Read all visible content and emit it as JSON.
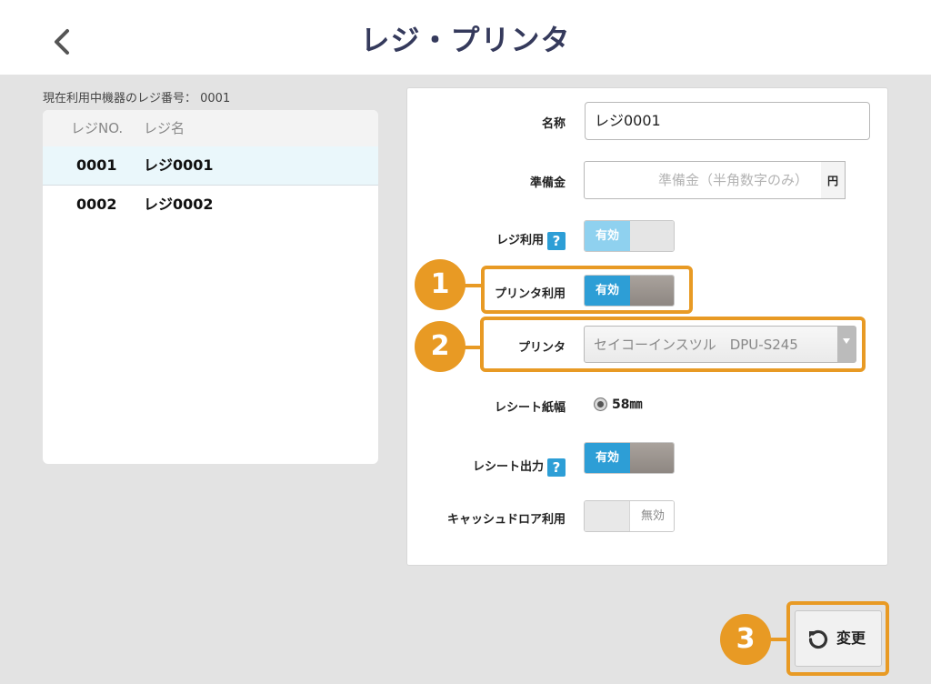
{
  "header": {
    "title": "レジ・プリンタ"
  },
  "current_register": "現在利用中機器のレジ番号： 0001",
  "list": {
    "columns": [
      "レジNO.",
      "レジ名"
    ],
    "rows": [
      {
        "no": "0001",
        "name": "レジ0001",
        "selected": true
      },
      {
        "no": "0002",
        "name": "レジ0002",
        "selected": false
      }
    ]
  },
  "form": {
    "name_label": "名称",
    "name_value": "レジ0001",
    "float_label": "準備金",
    "float_placeholder": "準備金（半角数字のみ）",
    "float_unit": "円",
    "register_use_label": "レジ利用",
    "register_use_state": "有効",
    "printer_use_label": "プリンタ利用",
    "printer_use_state": "有効",
    "printer_label": "プリンタ",
    "printer_value": "セイコーインスツル　DPU-S245",
    "receipt_width_label": "レシート紙幅",
    "receipt_width_value": "58㎜",
    "receipt_output_label": "レシート出力",
    "receipt_output_state": "有効",
    "drawer_use_label": "キャッシュドロア利用",
    "drawer_use_state": "無効",
    "help_glyph": "?"
  },
  "callouts": [
    "1",
    "2",
    "3"
  ],
  "change_button": "変更",
  "colors": {
    "accent": "#2d9ed6",
    "highlight": "#e89a24",
    "title": "#353a5c"
  }
}
